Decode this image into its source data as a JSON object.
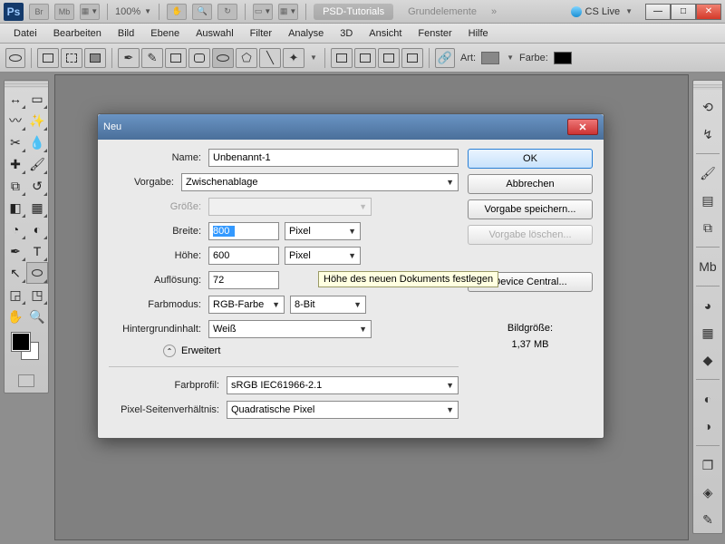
{
  "app_bar": {
    "logo": "Ps",
    "br": "Br",
    "mb": "Mb",
    "zoom": "100%",
    "tabs": {
      "active": "PSD-Tutorials",
      "inactive": "Grundelemente"
    },
    "cslive": "CS Live"
  },
  "menu": [
    "Datei",
    "Bearbeiten",
    "Bild",
    "Ebene",
    "Auswahl",
    "Filter",
    "Analyse",
    "3D",
    "Ansicht",
    "Fenster",
    "Hilfe"
  ],
  "options": {
    "art": "Art:",
    "farbe": "Farbe:"
  },
  "dialog": {
    "title": "Neu",
    "labels": {
      "name": "Name:",
      "vorgabe": "Vorgabe:",
      "groesse": "Größe:",
      "breite": "Breite:",
      "hoehe": "Höhe:",
      "aufloesung": "Auflösung:",
      "farbmodus": "Farbmodus:",
      "hintergrund": "Hintergrundinhalt:",
      "erweitert": "Erweitert",
      "farbprofil": "Farbprofil:",
      "pixelsv": "Pixel-Seitenverhältnis:"
    },
    "values": {
      "name": "Unbenannt-1",
      "vorgabe": "Zwischenablage",
      "breite": "800",
      "hoehe": "600",
      "aufloesung": "72",
      "unit_px": "Pixel",
      "farbmodus": "RGB-Farbe",
      "bit": "8-Bit",
      "hintergrund": "Weiß",
      "farbprofil": "sRGB IEC61966-2.1",
      "pixelsv": "Quadratische Pixel"
    },
    "buttons": {
      "ok": "OK",
      "abbrechen": "Abbrechen",
      "speichern": "Vorgabe speichern...",
      "loeschen": "Vorgabe löschen...",
      "device": "Device Central..."
    },
    "size_label": "Bildgröße:",
    "size_value": "1,37 MB",
    "tooltip": "Höhe des neuen Dokuments festlegen"
  }
}
